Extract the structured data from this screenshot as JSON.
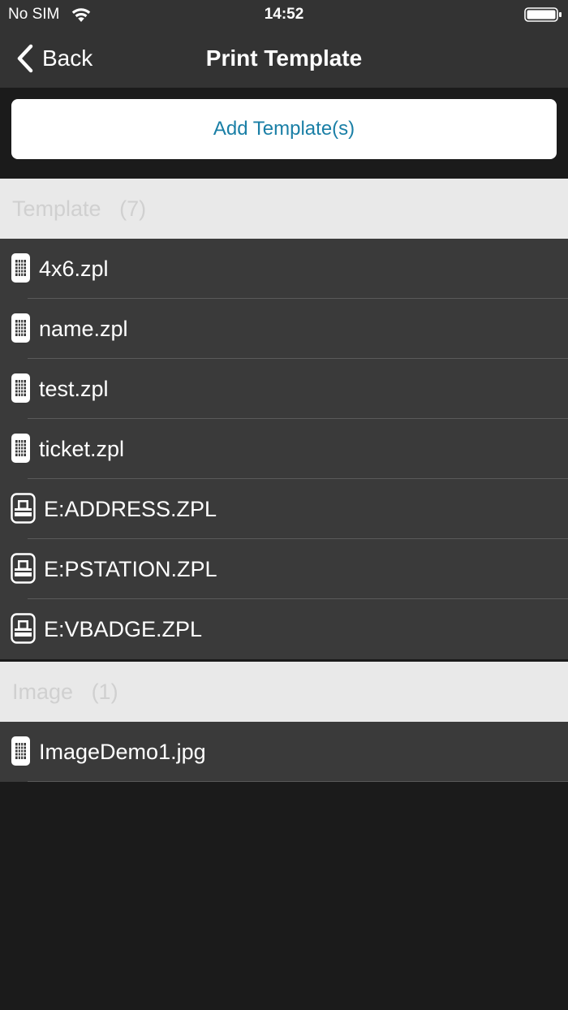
{
  "status_bar": {
    "carrier": "No SIM",
    "time": "14:52",
    "wifi_icon": "wifi-icon",
    "battery_icon": "battery-icon"
  },
  "nav": {
    "back_label": "Back",
    "back_icon": "chevron-left-icon",
    "title": "Print Template"
  },
  "add_button_label": "Add Template(s)",
  "colors": {
    "bar_background": "#333333",
    "page_background": "#1b1b1b",
    "row_background": "#3a3a3a",
    "section_header_background": "#e9e9e9",
    "accent": "#1a7fa6"
  },
  "sections": [
    {
      "title": "Template",
      "count": "(7)",
      "items": [
        {
          "label": "4x6.zpl",
          "icon": "file-icon"
        },
        {
          "label": "name.zpl",
          "icon": "file-icon"
        },
        {
          "label": "test.zpl",
          "icon": "file-icon"
        },
        {
          "label": "ticket.zpl",
          "icon": "file-icon"
        },
        {
          "label": "E:ADDRESS.ZPL",
          "icon": "printer-storage-icon"
        },
        {
          "label": "E:PSTATION.ZPL",
          "icon": "printer-storage-icon"
        },
        {
          "label": "E:VBADGE.ZPL",
          "icon": "printer-storage-icon"
        }
      ]
    },
    {
      "title": "Image",
      "count": "(1)",
      "items": [
        {
          "label": "ImageDemo1.jpg",
          "icon": "file-icon"
        }
      ]
    }
  ]
}
